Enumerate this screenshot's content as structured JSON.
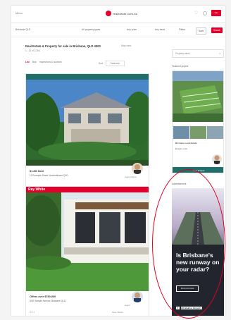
{
  "header": {
    "menu_label": "Menu",
    "logo_text": "realestate.com.au",
    "join_label": "Join"
  },
  "filters": {
    "location": "Brisbane QLD",
    "property_types": "All property types",
    "price": "Any price",
    "beds": "Any beds",
    "more": "Filters",
    "save_label": "Save",
    "search_label": "Search"
  },
  "results": {
    "title": "Real Estate & Property for sale in Brisbane, QLD 4000",
    "breadcrumb": "1 - 20 of 2,356",
    "map_view": "Map view",
    "tab_list": "List",
    "tab_map": "Map",
    "tab_inspections": "Inspections & auctions",
    "sort_label": "Sort:",
    "sort_value": "Featured"
  },
  "listings": [
    {
      "brand": "",
      "price": "$1.2M Sold",
      "address": "12 Example Street, Auchenflower QLD",
      "features": "4  2  2",
      "agent_name": "Agent Name",
      "actions": "Save  Share"
    },
    {
      "brand": "Ray White",
      "price": "Offers over $780,000",
      "address": "5/20 Sample Avenue, Brisbane QLD",
      "features": "3  2  1",
      "agent_name": "Agent",
      "actions": "Save  Share"
    }
  ],
  "sidebar": {
    "select_label": "Property alerts",
    "select_arrow": "▾",
    "section_label": "Featured project",
    "project_name": "Brisbane Land Estate",
    "project_sub": "Enquire now",
    "project_button": "View Project",
    "ad_label": "Advertisement",
    "ad_headline": "Is Brisbane's new runway on your radar?",
    "ad_cta": "Find out more",
    "ad_brand": "Brisbane Airport"
  },
  "colors": {
    "brand_red": "#e4002b",
    "annotation": "#e00020"
  }
}
